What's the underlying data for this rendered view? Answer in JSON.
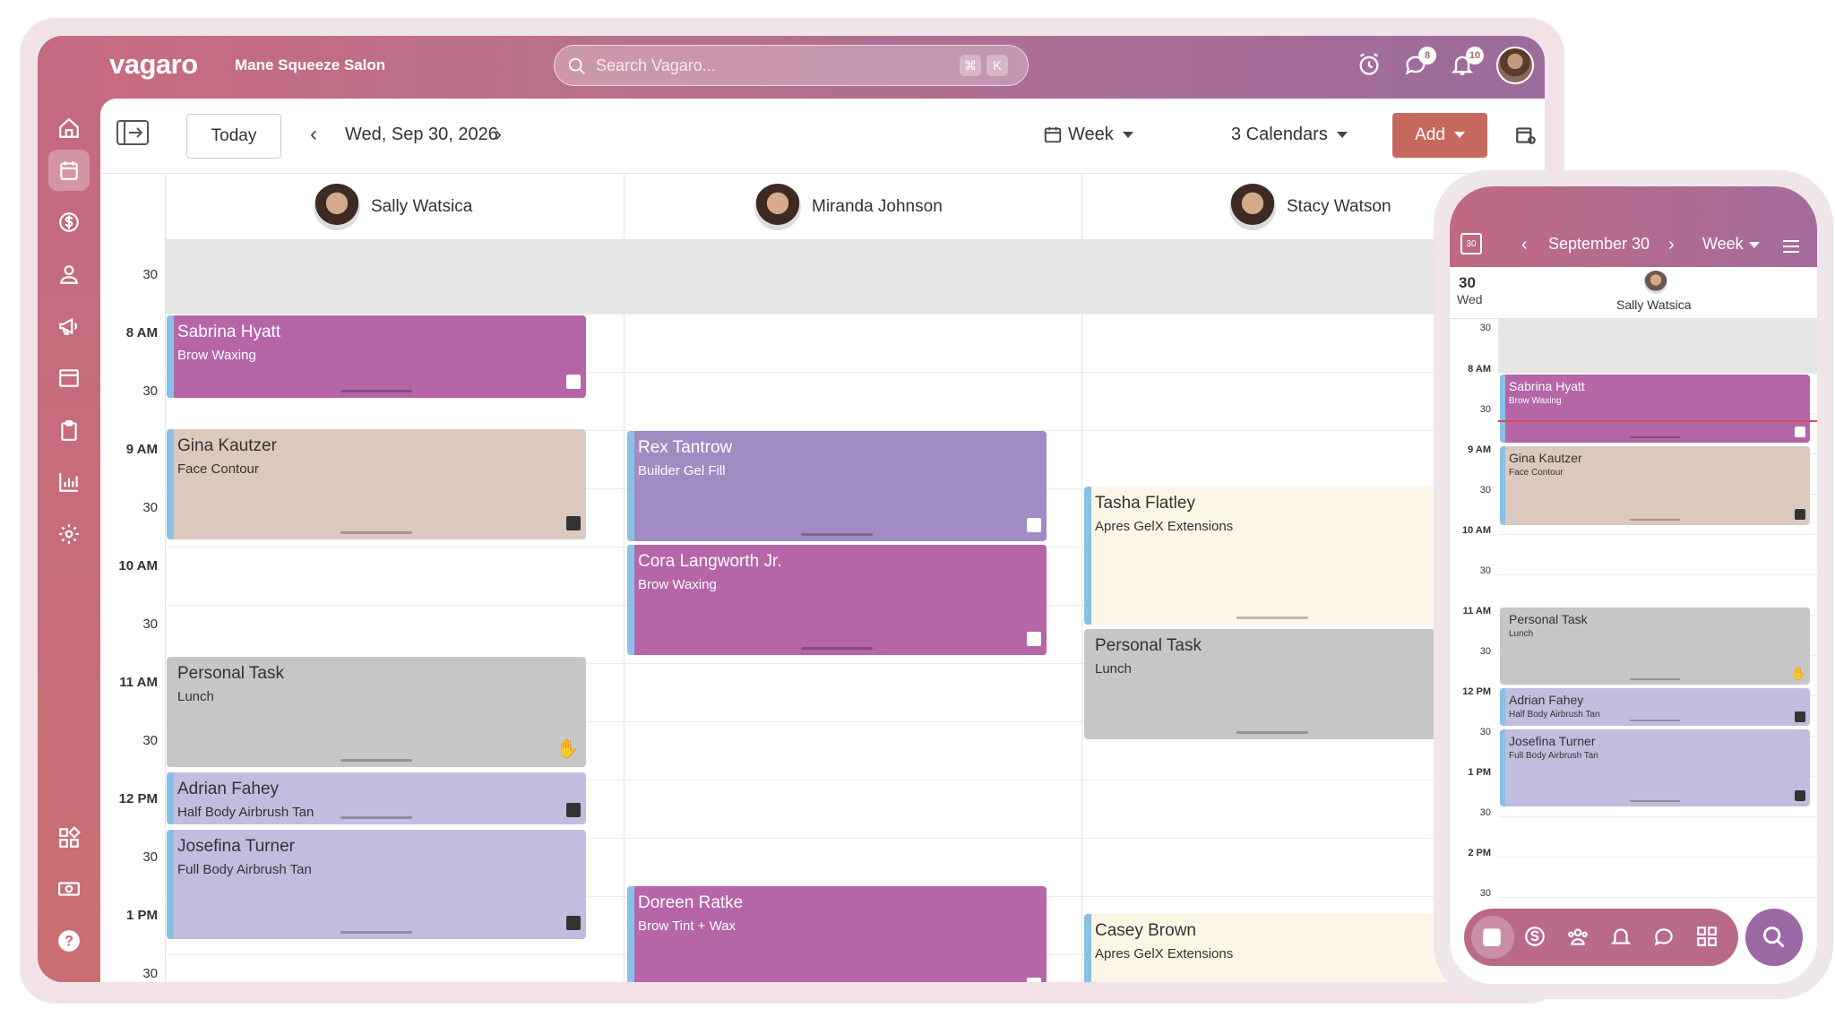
{
  "app": {
    "logo": "vagaro",
    "salon": "Mane Squeeze Salon"
  },
  "search": {
    "placeholder": "Search Vagaro...",
    "shortcut_1": "⌘",
    "shortcut_2": "K"
  },
  "badges": {
    "messages": "8",
    "notifications": "10"
  },
  "toolbar": {
    "today": "Today",
    "date": "Wed, Sep 30, 2026",
    "view": "Week",
    "calendars": "3 Calendars",
    "add": "Add"
  },
  "staff": [
    {
      "name": "Sally Watsica"
    },
    {
      "name": "Miranda Johnson"
    },
    {
      "name": "Stacy Watson"
    }
  ],
  "times": [
    "30",
    "8 AM",
    "30",
    "9 AM",
    "30",
    "10 AM",
    "30",
    "11 AM",
    "30",
    "12 PM",
    "30",
    "1 PM",
    "30"
  ],
  "appointments": {
    "a1": {
      "name": "Sabrina Hyatt",
      "service": "Brow Waxing"
    },
    "a2": {
      "name": "Gina Kautzer",
      "service": "Face Contour"
    },
    "a3": {
      "name": "Personal Task",
      "service": "Lunch"
    },
    "a4": {
      "name": "Adrian Fahey",
      "service": "Half Body Airbrush Tan"
    },
    "a5": {
      "name": "Josefina Turner",
      "service": "Full Body Airbrush Tan"
    },
    "b1": {
      "name": "Rex Tantrow",
      "service": "Builder Gel Fill"
    },
    "b2": {
      "name": "Cora Langworth Jr.",
      "service": "Brow Waxing"
    },
    "b3": {
      "name": "Doreen Ratke",
      "service": "Brow Tint + Wax"
    },
    "c1": {
      "name": "Tasha Flatley",
      "service": "Apres GelX Extensions"
    },
    "c2": {
      "name": "Personal Task",
      "service": "Lunch"
    },
    "c3": {
      "name": "Casey Brown",
      "service": "Apres GelX Extensions"
    }
  },
  "phone": {
    "cal_day": "30",
    "month": "September 30",
    "view": "Week",
    "day_num": "30",
    "day_name": "Wed",
    "staff": "Sally Watsica",
    "times": [
      "30",
      "8 AM",
      "30",
      "9 AM",
      "30",
      "10 AM",
      "30",
      "11 AM",
      "30",
      "12 PM",
      "30",
      "1 PM",
      "30",
      "2 PM",
      "30"
    ],
    "appointments": {
      "p1": {
        "name": "Sabrina Hyatt",
        "service": "Brow Waxing"
      },
      "p2": {
        "name": "Gina Kautzer",
        "service": "Face Contour"
      },
      "p3": {
        "name": "Personal Task",
        "service": "Lunch"
      },
      "p4": {
        "name": "Adrian Fahey",
        "service": "Half Body Airbrush Tan"
      },
      "p5": {
        "name": "Josefina Turner",
        "service": "Full Body Airbrush Tan"
      }
    }
  },
  "colors": {
    "purple": "#b565a8",
    "tan": "#dcc9bd",
    "lavender": "#a08bc3",
    "grey": "#c6c6c6",
    "lilac": "#c1bddf",
    "cream": "#fdf6e6",
    "add_button": "#c7685f"
  }
}
